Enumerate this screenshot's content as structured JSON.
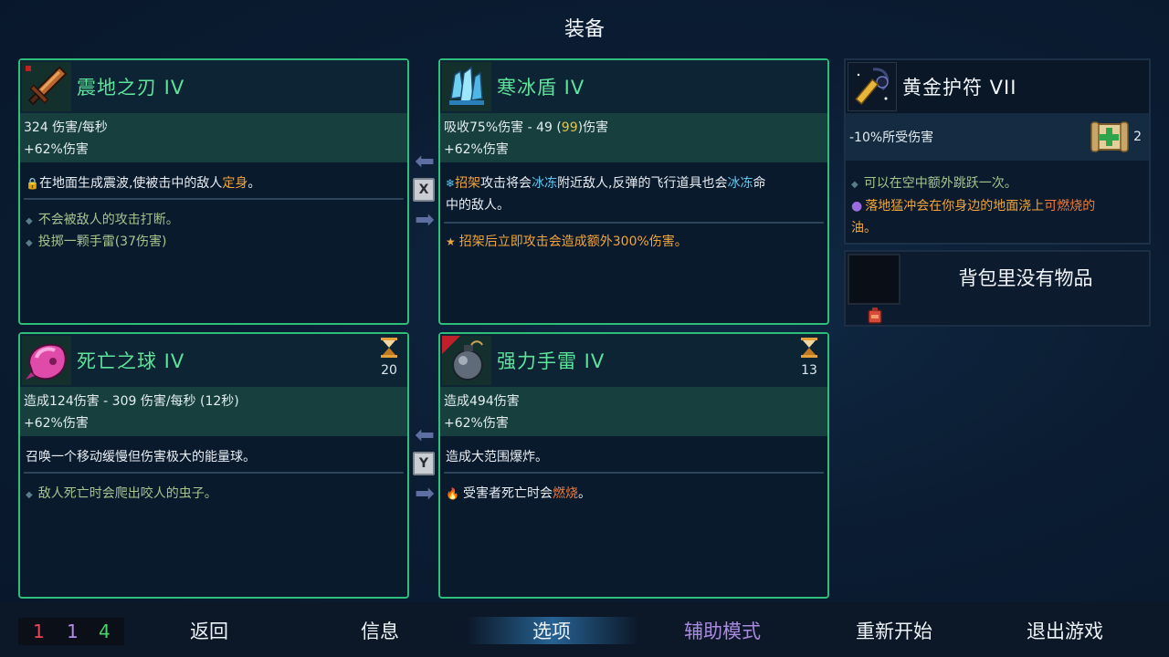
{
  "screen_title": "装备",
  "weapons": [
    {
      "name": "震地之刃 IV",
      "icon": "blade-icon",
      "stat_lines": [
        "324 伤害/每秒",
        "+62%伤害"
      ],
      "desc_pre": "在地面生成震波,使被击中的敌人",
      "desc_highlight": "定身",
      "desc_post": "。",
      "bullets": [
        "不会被敌人的攻击打断。",
        "投掷一颗手雷(37伤害)"
      ]
    },
    {
      "name": "寒冰盾 IV",
      "icon": "ice-shield-icon",
      "stat_pre": "吸收75%伤害 - 49 (",
      "stat_gold": "99",
      "stat_post": ")伤害",
      "stat_line2": "+62%伤害",
      "desc_l1_a": "招架",
      "desc_l1_b": "攻击将会",
      "desc_l1_c": "冰冻",
      "desc_l1_d": "附近敌人,反弹的飞行道具也会",
      "desc_l1_e": "冰冻",
      "desc_l1_f": "命",
      "desc_l2": "中的敌人。",
      "bonus": "招架后立即攻击会造成额外300%伤害。"
    }
  ],
  "skills": [
    {
      "name": "死亡之球 IV",
      "icon": "death-orb-icon",
      "cooldown": "20",
      "stat_lines": [
        "造成124伤害 - 309 伤害/每秒 (12秒)",
        "+62%伤害"
      ],
      "desc": "召唤一个移动缓慢但伤害极大的能量球。",
      "bullets": [
        "敌人死亡时会爬出咬人的虫子。"
      ]
    },
    {
      "name": "强力手雷 IV",
      "icon": "grenade-icon",
      "cooldown": "13",
      "stat_lines": [
        "造成494伤害",
        "+62%伤害"
      ],
      "desc": "造成大范围爆炸。",
      "bonus_pre": "受害者死亡时会",
      "bonus_highlight": "燃烧",
      "bonus_post": "。"
    }
  ],
  "swap_keys": [
    "X",
    "Y"
  ],
  "amulet": {
    "name": "黄金护符 VII",
    "icon": "amulet-icon",
    "stat": "-10%所受伤害",
    "scroll_count": "2",
    "bullet1": "可以在空中额外跳跃一次。",
    "bullet2_pre": "落地猛冲会在你身边的地面浇上",
    "bullet2_highlight": "可燃烧的",
    "bullet2_post": "油。"
  },
  "backpack": {
    "empty_text": "背包里没有物品"
  },
  "counters": [
    {
      "value": "1",
      "color": "#e6475a"
    },
    {
      "value": "1",
      "color": "#b38be8"
    },
    {
      "value": "4",
      "color": "#49d36a"
    }
  ],
  "menu": {
    "back": "返回",
    "info": "信息",
    "options": "选项",
    "assist": "辅助模式",
    "restart": "重新开始",
    "quit": "退出游戏"
  },
  "colors": {
    "card_border": "#2fbd7a",
    "item_name": "#5ee39a",
    "assist_mode": "#a98ae0",
    "highlight_orange": "#f1a53a",
    "highlight_cyan": "#5fc8f0"
  }
}
